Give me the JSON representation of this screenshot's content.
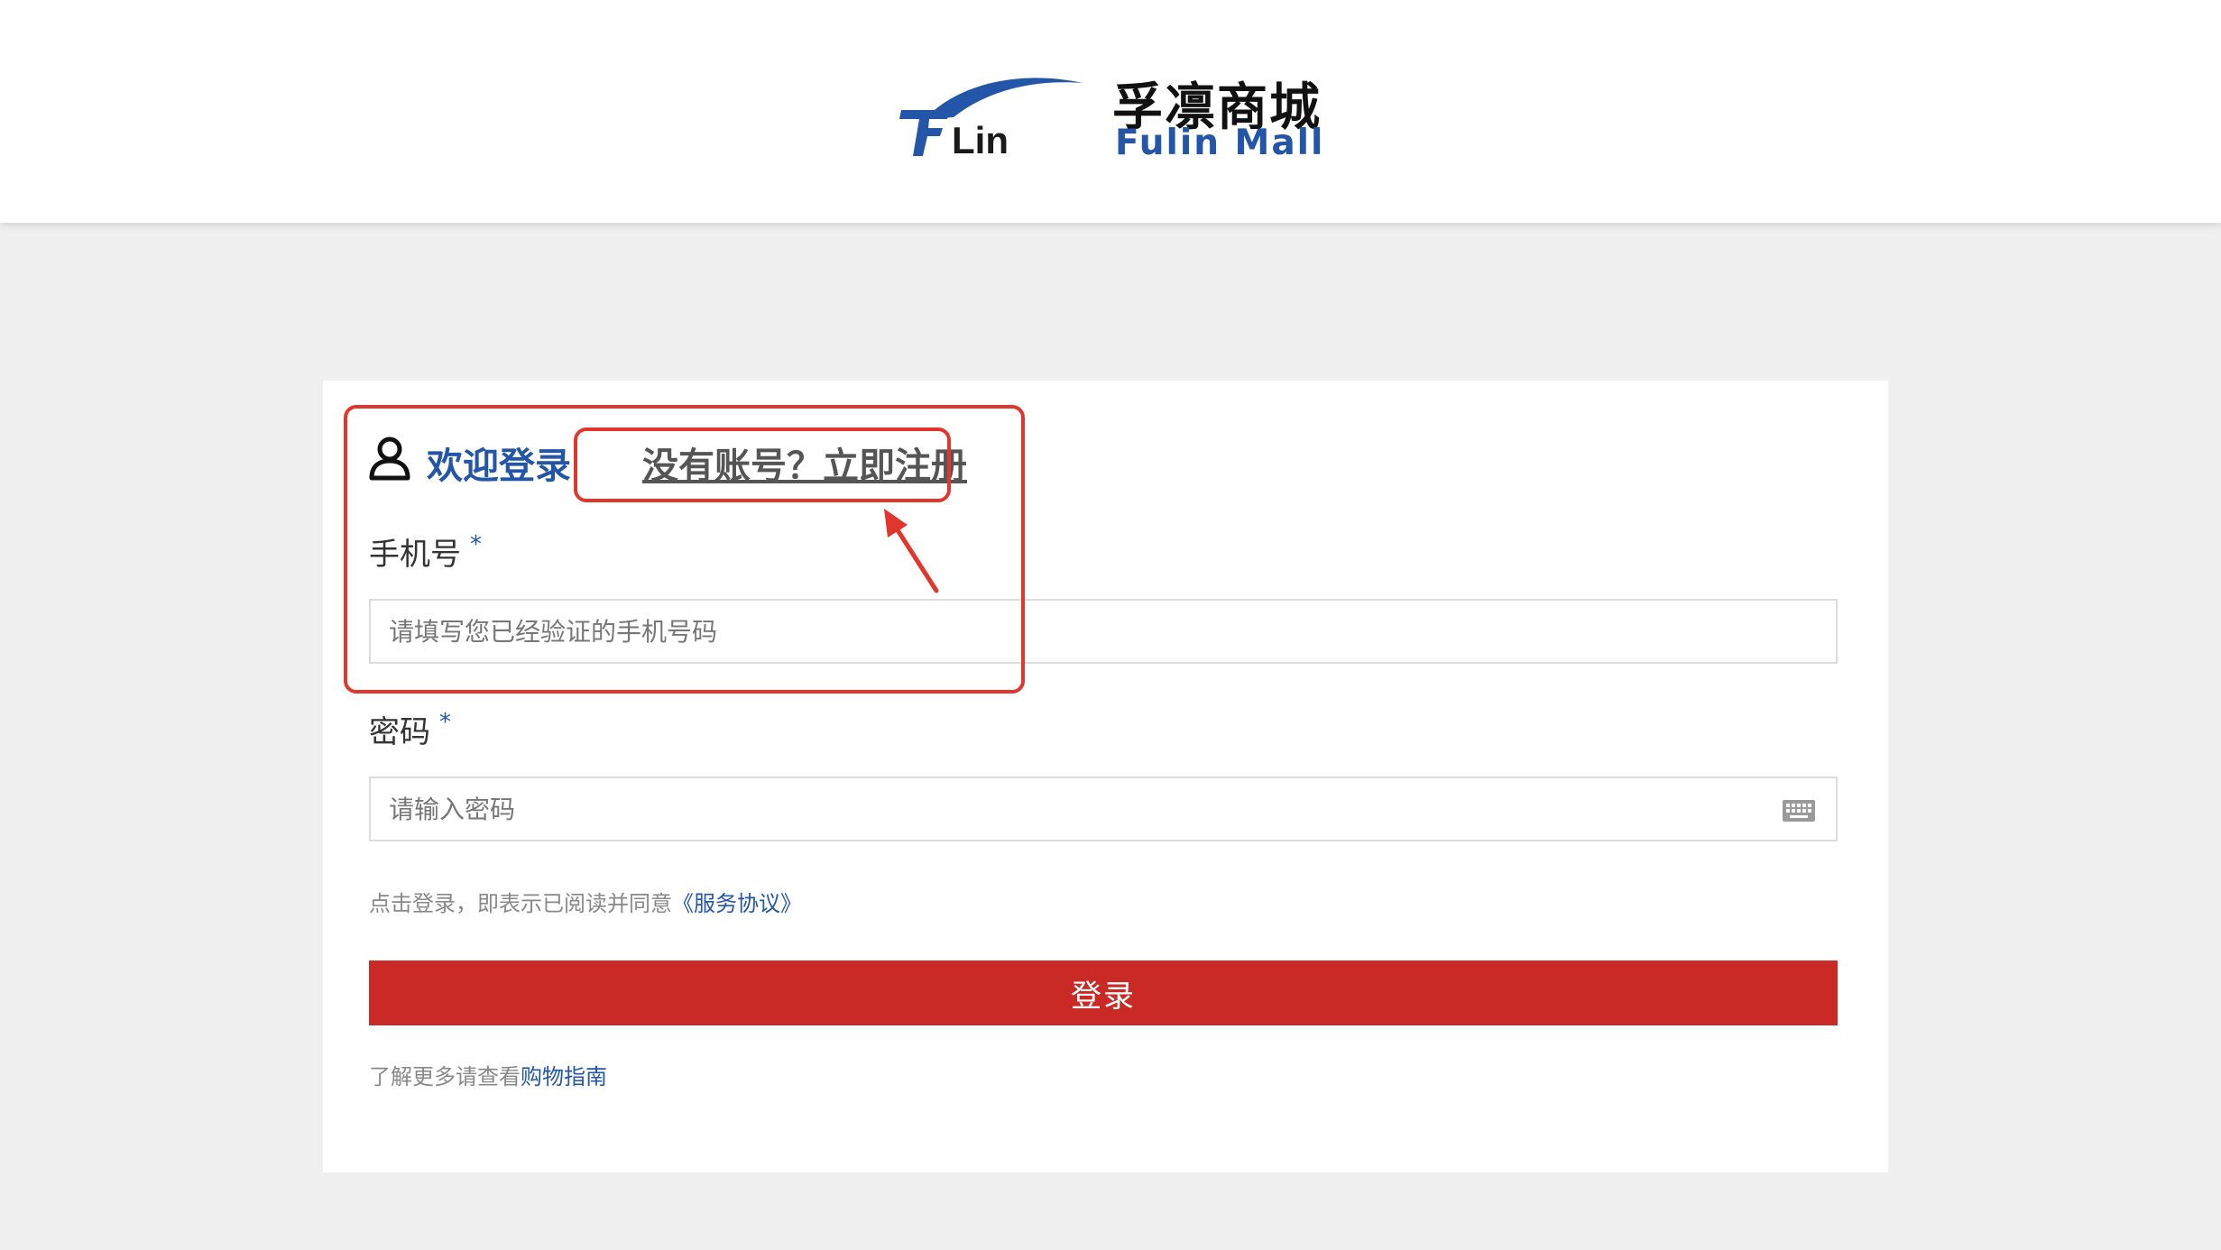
{
  "header": {
    "logo_mark_text": "FLin",
    "logo_cn": "孚凛商城",
    "logo_en": "Fulin Mall"
  },
  "login": {
    "welcome": "欢迎登录",
    "register_link": "没有账号？立即注册",
    "phone_label": "手机号",
    "phone_required": "*",
    "phone_placeholder": "请填写您已经验证的手机号码",
    "password_label": "密码",
    "password_required": "*",
    "password_placeholder": "请输入密码",
    "agree_text": "点击登录，即表示已阅读并同意",
    "agree_link": "《服务协议》",
    "login_button": "登录",
    "guide_text": "了解更多请查看",
    "guide_link": "购物指南"
  },
  "colors": {
    "brand_blue": "#2356a8",
    "login_red": "#c92a25",
    "annotation_red": "#e0362c"
  },
  "icons": {
    "user": "user-icon",
    "keyboard": "keyboard-icon"
  }
}
